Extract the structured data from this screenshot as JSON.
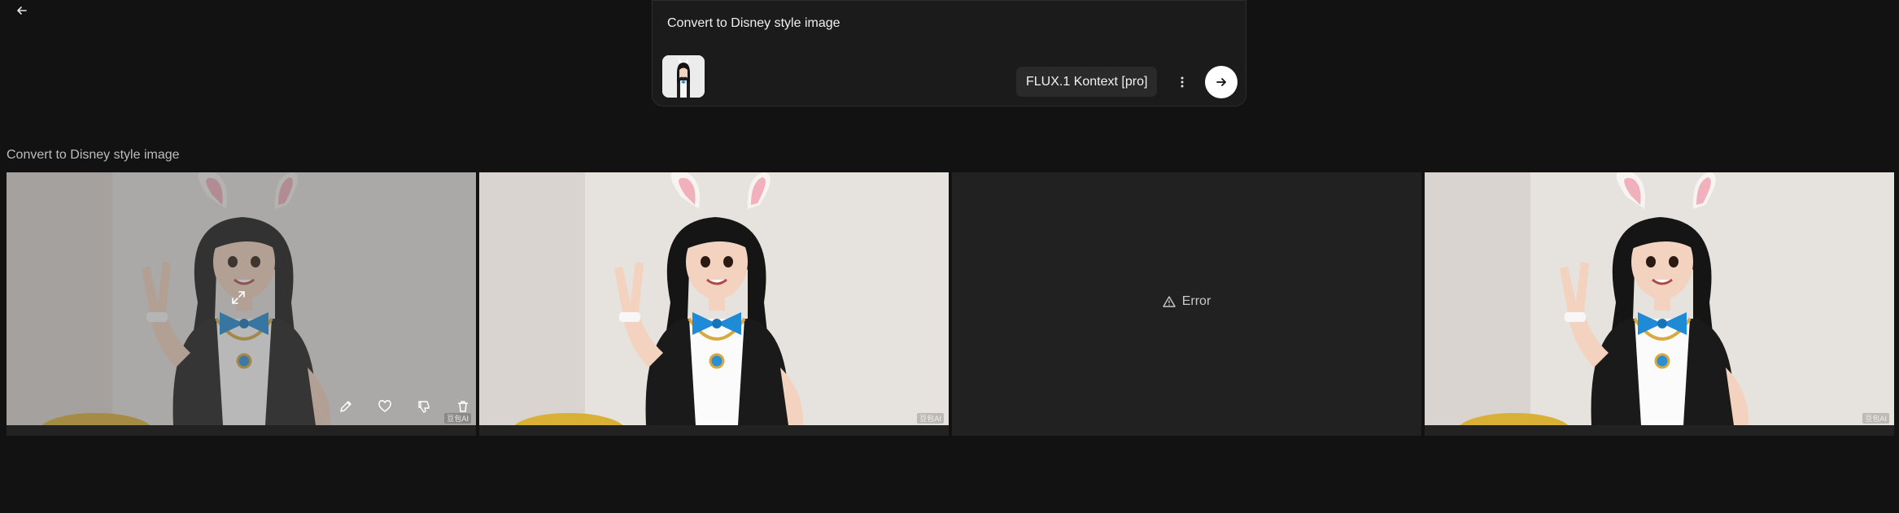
{
  "prompt": {
    "text": "Convert to Disney style image",
    "model_label": "FLUX.1 Kontext [pro]"
  },
  "section": {
    "title": "Convert to Disney style image"
  },
  "results": [
    {
      "status": "image",
      "watermark": "豆包AI",
      "hovered": true
    },
    {
      "status": "image",
      "watermark": "豆包AI"
    },
    {
      "status": "error",
      "error_label": "Error"
    },
    {
      "status": "image",
      "watermark": "豆包AI"
    }
  ],
  "icons": {
    "back": "arrow-left-icon",
    "more": "more-vertical-icon",
    "submit": "arrow-right-icon",
    "edit": "pencil-icon",
    "like": "heart-icon",
    "dislike": "thumbs-down-icon",
    "delete": "trash-icon",
    "expand": "expand-icon",
    "error": "warning-icon"
  },
  "colors": {
    "background": "#121212",
    "panel": "#1b1b1b",
    "accent": "#1f8ad6"
  }
}
